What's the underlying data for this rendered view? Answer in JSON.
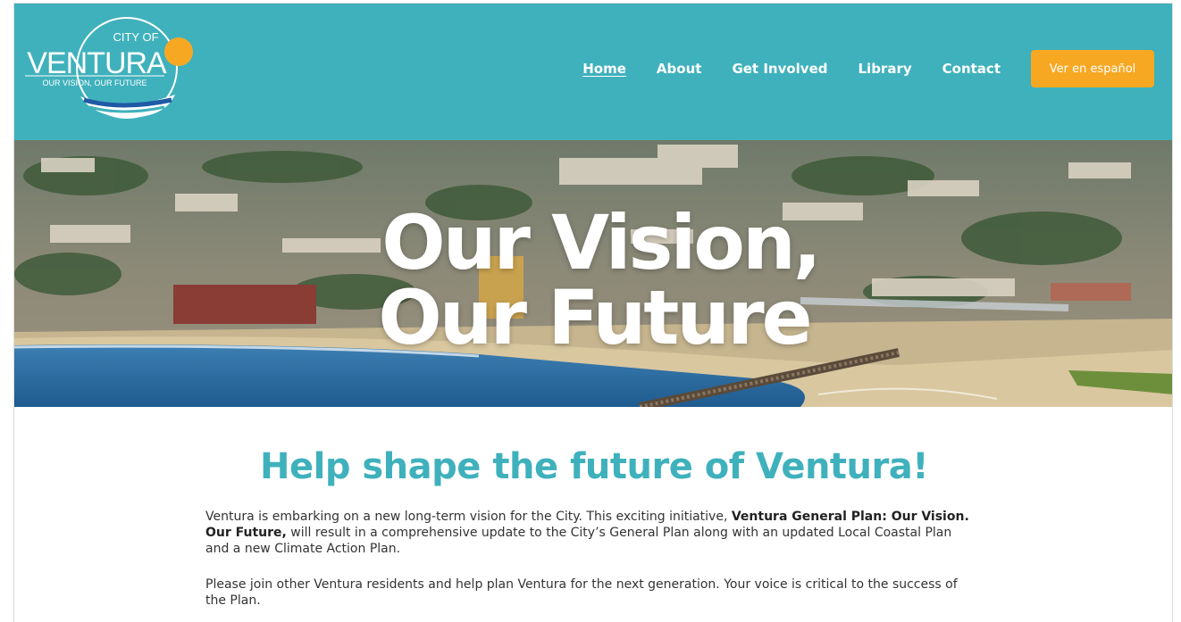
{
  "logo": {
    "city_of": "CITY OF",
    "name": "VENTURA",
    "tagline": "OUR VISION, OUR FUTURE"
  },
  "nav": {
    "items": [
      {
        "label": "Home",
        "active": true
      },
      {
        "label": "About",
        "active": false
      },
      {
        "label": "Get Involved",
        "active": false
      },
      {
        "label": "Library",
        "active": false
      },
      {
        "label": "Contact",
        "active": false
      }
    ],
    "language_button": "Ver en español"
  },
  "hero": {
    "line1": "Our Vision,",
    "line2": "Our Future"
  },
  "main": {
    "headline": "Help shape the future of Ventura!",
    "para1_start": "Ventura is embarking on a new long-term vision for the City. This exciting initiative, ",
    "para1_bold": "Ventura General Plan: Our Vision. Our Future,",
    "para1_end": " will result in a comprehensive update to the City’s General Plan along with an updated Local Coastal Plan and a new Climate Action Plan.",
    "para2": "Please join other Ventura residents and help plan Ventura for the next generation. Your voice is critical to the success of the Plan."
  },
  "colors": {
    "header_bg": "#3fb1bc",
    "accent": "#f7a823",
    "headline": "#3fb1bc"
  }
}
